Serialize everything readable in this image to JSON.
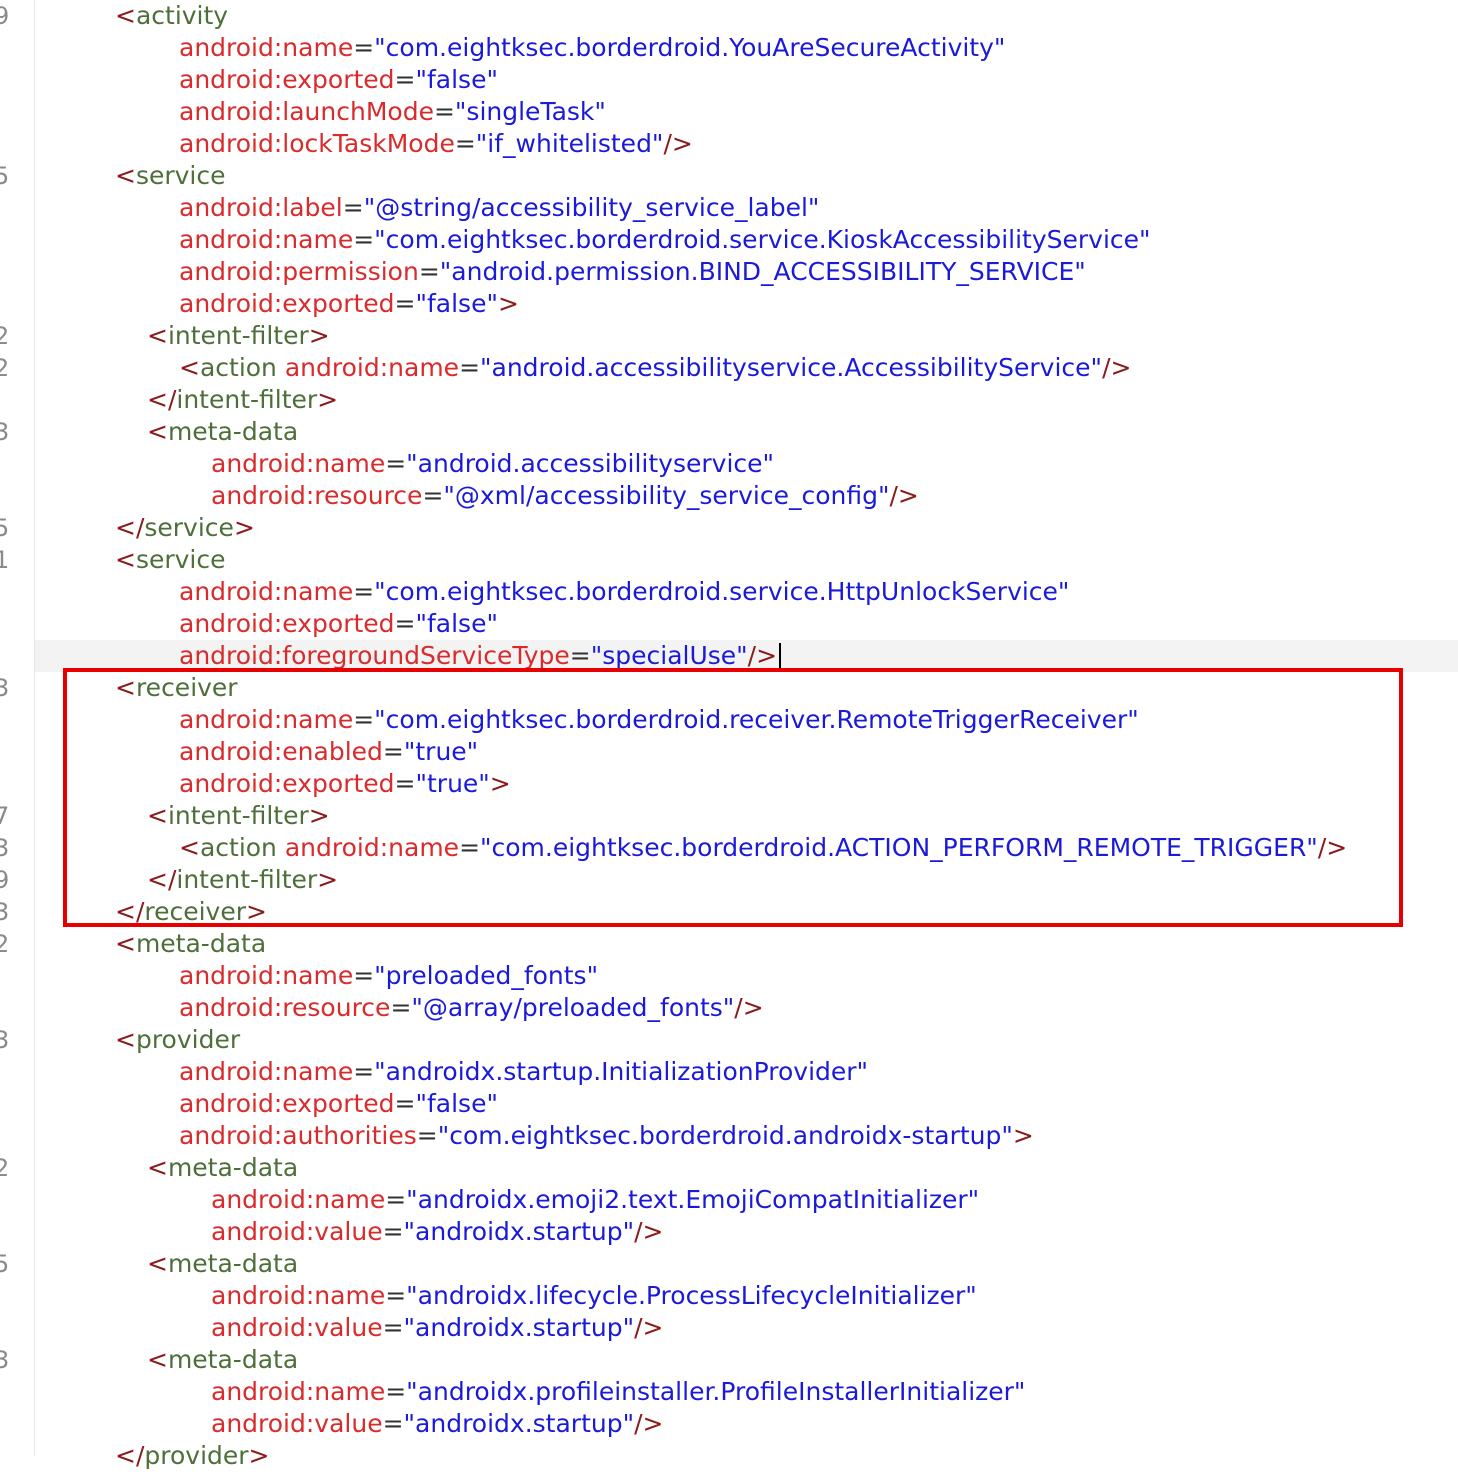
{
  "gutter": {
    "line_marks": [
      "9",
      "5",
      "2",
      "2",
      "3",
      "5",
      "1",
      "3",
      "7",
      "3",
      "9",
      "3",
      "2",
      "3",
      "2",
      "5",
      "3"
    ]
  },
  "code": {
    "lines": [
      {
        "parts": [
          {
            "k": "brk",
            "t": "<"
          },
          {
            "k": "tag",
            "t": "activity"
          }
        ]
      },
      {
        "parts": [
          {
            "k": "attr",
            "t": "android:name"
          },
          {
            "k": "eq",
            "t": "="
          },
          {
            "k": "val",
            "t": "\"com.eightksec.borderdroid.YouAreSecureActivity\""
          }
        ]
      },
      {
        "parts": [
          {
            "k": "attr",
            "t": "android:exported"
          },
          {
            "k": "eq",
            "t": "="
          },
          {
            "k": "val",
            "t": "\"false\""
          }
        ]
      },
      {
        "parts": [
          {
            "k": "attr",
            "t": "android:launchMode"
          },
          {
            "k": "eq",
            "t": "="
          },
          {
            "k": "val",
            "t": "\"singleTask\""
          }
        ]
      },
      {
        "parts": [
          {
            "k": "attr",
            "t": "android:lockTaskMode"
          },
          {
            "k": "eq",
            "t": "="
          },
          {
            "k": "val",
            "t": "\"if_whitelisted\""
          },
          {
            "k": "brk",
            "t": "/>"
          }
        ]
      },
      {
        "parts": [
          {
            "k": "brk",
            "t": "<"
          },
          {
            "k": "tag",
            "t": "service"
          }
        ]
      },
      {
        "parts": [
          {
            "k": "attr",
            "t": "android:label"
          },
          {
            "k": "eq",
            "t": "="
          },
          {
            "k": "val",
            "t": "\"@string/accessibility_service_label\""
          }
        ]
      },
      {
        "parts": [
          {
            "k": "attr",
            "t": "android:name"
          },
          {
            "k": "eq",
            "t": "="
          },
          {
            "k": "val",
            "t": "\"com.eightksec.borderdroid.service.KioskAccessibilityService\""
          }
        ]
      },
      {
        "parts": [
          {
            "k": "attr",
            "t": "android:permission"
          },
          {
            "k": "eq",
            "t": "="
          },
          {
            "k": "val",
            "t": "\"android.permission.BIND_ACCESSIBILITY_SERVICE\""
          }
        ]
      },
      {
        "parts": [
          {
            "k": "attr",
            "t": "android:exported"
          },
          {
            "k": "eq",
            "t": "="
          },
          {
            "k": "val",
            "t": "\"false\""
          },
          {
            "k": "brk",
            "t": ">"
          }
        ]
      },
      {
        "parts": [
          {
            "k": "brk",
            "t": "<"
          },
          {
            "k": "tag",
            "t": "intent-filter"
          },
          {
            "k": "brk",
            "t": ">"
          }
        ]
      },
      {
        "parts": [
          {
            "k": "brk",
            "t": "<"
          },
          {
            "k": "tag",
            "t": "action "
          },
          {
            "k": "attr",
            "t": "android:name"
          },
          {
            "k": "eq",
            "t": "="
          },
          {
            "k": "val",
            "t": "\"android.accessibilityservice.AccessibilityService\""
          },
          {
            "k": "brk",
            "t": "/>"
          }
        ]
      },
      {
        "parts": [
          {
            "k": "brk",
            "t": "</"
          },
          {
            "k": "tag",
            "t": "intent-filter"
          },
          {
            "k": "brk",
            "t": ">"
          }
        ]
      },
      {
        "parts": [
          {
            "k": "brk",
            "t": "<"
          },
          {
            "k": "tag",
            "t": "meta-data"
          }
        ]
      },
      {
        "parts": [
          {
            "k": "attr",
            "t": "android:name"
          },
          {
            "k": "eq",
            "t": "="
          },
          {
            "k": "val",
            "t": "\"android.accessibilityservice\""
          }
        ]
      },
      {
        "parts": [
          {
            "k": "attr",
            "t": "android:resource"
          },
          {
            "k": "eq",
            "t": "="
          },
          {
            "k": "val",
            "t": "\"@xml/accessibility_service_config\""
          },
          {
            "k": "brk",
            "t": "/>"
          }
        ]
      },
      {
        "parts": [
          {
            "k": "brk",
            "t": "</"
          },
          {
            "k": "tag",
            "t": "service"
          },
          {
            "k": "brk",
            "t": ">"
          }
        ]
      },
      {
        "parts": [
          {
            "k": "brk",
            "t": "<"
          },
          {
            "k": "tag",
            "t": "service"
          }
        ]
      },
      {
        "parts": [
          {
            "k": "attr",
            "t": "android:name"
          },
          {
            "k": "eq",
            "t": "="
          },
          {
            "k": "val",
            "t": "\"com.eightksec.borderdroid.service.HttpUnlockService\""
          }
        ]
      },
      {
        "parts": [
          {
            "k": "attr",
            "t": "android:exported"
          },
          {
            "k": "eq",
            "t": "="
          },
          {
            "k": "val",
            "t": "\"false\""
          }
        ]
      },
      {
        "parts": [
          {
            "k": "attr",
            "t": "android:foregroundServiceType"
          },
          {
            "k": "eq",
            "t": "="
          },
          {
            "k": "val",
            "t": "\"specialUse\""
          },
          {
            "k": "brk",
            "t": "/>"
          }
        ],
        "caret": true
      },
      {
        "parts": [
          {
            "k": "brk",
            "t": "<"
          },
          {
            "k": "tag",
            "t": "receiver"
          }
        ]
      },
      {
        "parts": [
          {
            "k": "attr",
            "t": "android:name"
          },
          {
            "k": "eq",
            "t": "="
          },
          {
            "k": "val",
            "t": "\"com.eightksec.borderdroid.receiver.RemoteTriggerReceiver\""
          }
        ]
      },
      {
        "parts": [
          {
            "k": "attr",
            "t": "android:enabled"
          },
          {
            "k": "eq",
            "t": "="
          },
          {
            "k": "val",
            "t": "\"true\""
          }
        ]
      },
      {
        "parts": [
          {
            "k": "attr",
            "t": "android:exported"
          },
          {
            "k": "eq",
            "t": "="
          },
          {
            "k": "val",
            "t": "\"true\""
          },
          {
            "k": "brk",
            "t": ">"
          }
        ]
      },
      {
        "parts": [
          {
            "k": "brk",
            "t": "<"
          },
          {
            "k": "tag",
            "t": "intent-filter"
          },
          {
            "k": "brk",
            "t": ">"
          }
        ]
      },
      {
        "parts": [
          {
            "k": "brk",
            "t": "<"
          },
          {
            "k": "tag",
            "t": "action "
          },
          {
            "k": "attr",
            "t": "android:name"
          },
          {
            "k": "eq",
            "t": "="
          },
          {
            "k": "val",
            "t": "\"com.eightksec.borderdroid.ACTION_PERFORM_REMOTE_TRIGGER\""
          },
          {
            "k": "brk",
            "t": "/>"
          }
        ]
      },
      {
        "parts": [
          {
            "k": "brk",
            "t": "</"
          },
          {
            "k": "tag",
            "t": "intent-filter"
          },
          {
            "k": "brk",
            "t": ">"
          }
        ]
      },
      {
        "parts": [
          {
            "k": "brk",
            "t": "</"
          },
          {
            "k": "tag",
            "t": "receiver"
          },
          {
            "k": "brk",
            "t": ">"
          }
        ]
      },
      {
        "parts": [
          {
            "k": "brk",
            "t": "<"
          },
          {
            "k": "tag",
            "t": "meta-data"
          }
        ]
      },
      {
        "parts": [
          {
            "k": "attr",
            "t": "android:name"
          },
          {
            "k": "eq",
            "t": "="
          },
          {
            "k": "val",
            "t": "\"preloaded_fonts\""
          }
        ]
      },
      {
        "parts": [
          {
            "k": "attr",
            "t": "android:resource"
          },
          {
            "k": "eq",
            "t": "="
          },
          {
            "k": "val",
            "t": "\"@array/preloaded_fonts\""
          },
          {
            "k": "brk",
            "t": "/>"
          }
        ]
      },
      {
        "parts": [
          {
            "k": "brk",
            "t": "<"
          },
          {
            "k": "tag",
            "t": "provider"
          }
        ]
      },
      {
        "parts": [
          {
            "k": "attr",
            "t": "android:name"
          },
          {
            "k": "eq",
            "t": "="
          },
          {
            "k": "val",
            "t": "\"androidx.startup.InitializationProvider\""
          }
        ]
      },
      {
        "parts": [
          {
            "k": "attr",
            "t": "android:exported"
          },
          {
            "k": "eq",
            "t": "="
          },
          {
            "k": "val",
            "t": "\"false\""
          }
        ]
      },
      {
        "parts": [
          {
            "k": "attr",
            "t": "android:authorities"
          },
          {
            "k": "eq",
            "t": "="
          },
          {
            "k": "val",
            "t": "\"com.eightksec.borderdroid.androidx-startup\""
          },
          {
            "k": "brk",
            "t": ">"
          }
        ]
      },
      {
        "parts": [
          {
            "k": "brk",
            "t": "<"
          },
          {
            "k": "tag",
            "t": "meta-data"
          }
        ]
      },
      {
        "parts": [
          {
            "k": "attr",
            "t": "android:name"
          },
          {
            "k": "eq",
            "t": "="
          },
          {
            "k": "val",
            "t": "\"androidx.emoji2.text.EmojiCompatInitializer\""
          }
        ]
      },
      {
        "parts": [
          {
            "k": "attr",
            "t": "android:value"
          },
          {
            "k": "eq",
            "t": "="
          },
          {
            "k": "val",
            "t": "\"androidx.startup\""
          },
          {
            "k": "brk",
            "t": "/>"
          }
        ]
      },
      {
        "parts": [
          {
            "k": "brk",
            "t": "<"
          },
          {
            "k": "tag",
            "t": "meta-data"
          }
        ]
      },
      {
        "parts": [
          {
            "k": "attr",
            "t": "android:name"
          },
          {
            "k": "eq",
            "t": "="
          },
          {
            "k": "val",
            "t": "\"androidx.lifecycle.ProcessLifecycleInitializer\""
          }
        ]
      },
      {
        "parts": [
          {
            "k": "attr",
            "t": "android:value"
          },
          {
            "k": "eq",
            "t": "="
          },
          {
            "k": "val",
            "t": "\"androidx.startup\""
          },
          {
            "k": "brk",
            "t": "/>"
          }
        ]
      },
      {
        "parts": [
          {
            "k": "brk",
            "t": "<"
          },
          {
            "k": "tag",
            "t": "meta-data"
          }
        ]
      },
      {
        "parts": [
          {
            "k": "attr",
            "t": "android:name"
          },
          {
            "k": "eq",
            "t": "="
          },
          {
            "k": "val",
            "t": "\"androidx.profileinstaller.ProfileInstallerInitializer\""
          }
        ]
      },
      {
        "parts": [
          {
            "k": "attr",
            "t": "android:value"
          },
          {
            "k": "eq",
            "t": "="
          },
          {
            "k": "val",
            "t": "\"androidx.startup\""
          },
          {
            "k": "brk",
            "t": "/>"
          }
        ]
      },
      {
        "parts": [
          {
            "k": "brk",
            "t": "</"
          },
          {
            "k": "tag",
            "t": "provider"
          },
          {
            "k": "brk",
            "t": ">"
          }
        ]
      }
    ]
  }
}
